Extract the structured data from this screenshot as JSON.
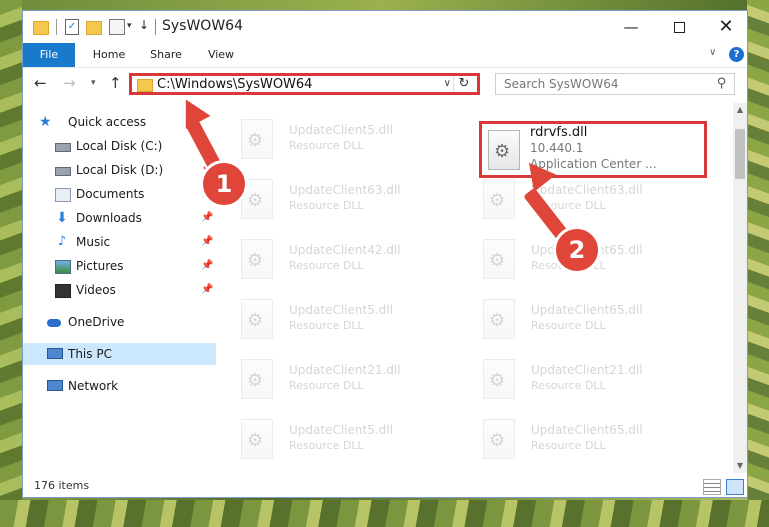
{
  "window": {
    "title": "SysWOW64",
    "controls": {
      "minimize": "—",
      "close": "✕"
    }
  },
  "ribbon": {
    "tabs": [
      "File",
      "Home",
      "Share",
      "View"
    ],
    "help": "?"
  },
  "navbar": {
    "address": "C:\\Windows\\SysWOW64",
    "search_placeholder": "Search SysWOW64"
  },
  "sidebar": {
    "items": [
      {
        "label": "Quick access",
        "icon": "star-icon"
      },
      {
        "label": "Local Disk (C:)",
        "icon": "disk-icon",
        "pinned": true
      },
      {
        "label": "Local Disk (D:)",
        "icon": "disk-icon",
        "pinned": true
      },
      {
        "label": "Documents",
        "icon": "documents-icon",
        "pinned": true
      },
      {
        "label": "Downloads",
        "icon": "download-icon",
        "pinned": true
      },
      {
        "label": "Music",
        "icon": "music-icon",
        "pinned": true
      },
      {
        "label": "Pictures",
        "icon": "pictures-icon",
        "pinned": true
      },
      {
        "label": "Videos",
        "icon": "videos-icon",
        "pinned": true
      },
      {
        "label": "OneDrive",
        "icon": "onedrive-icon"
      },
      {
        "label": "This PC",
        "icon": "computer-icon",
        "selected": true
      },
      {
        "label": "Network",
        "icon": "network-icon"
      }
    ]
  },
  "files": {
    "highlighted": {
      "name": "rdrvfs.dll",
      "version": "10.440.1",
      "description": "Application Center ..."
    },
    "left": [
      {
        "name": "UpdateClient5.dll",
        "type": "Resource DLL"
      },
      {
        "name": "UpdateClient63.dll",
        "type": "Resource DLL"
      },
      {
        "name": "UpdateClient42.dll",
        "type": "Resource DLL"
      },
      {
        "name": "UpdateClient5.dll",
        "type": "Resource DLL"
      },
      {
        "name": "UpdateClient21.dll",
        "type": "Resource DLL"
      },
      {
        "name": "UpdateClient5.dll",
        "type": "Resource DLL"
      }
    ],
    "right": [
      {
        "name": "UpdateClient63.dll",
        "type": "Resource DLL"
      },
      {
        "name": "UpdateClient65.dll",
        "type": "Resource DLL"
      },
      {
        "name": "UpdateClient65.dll",
        "type": "Resource DLL"
      },
      {
        "name": "UpdateClient21.dll",
        "type": "Resource DLL"
      },
      {
        "name": "UpdateClient65.dll",
        "type": "Resource DLL"
      }
    ]
  },
  "status": {
    "count": "176 items"
  },
  "annotations": {
    "step1": "1",
    "step2": "2",
    "color": "#e0453a"
  }
}
